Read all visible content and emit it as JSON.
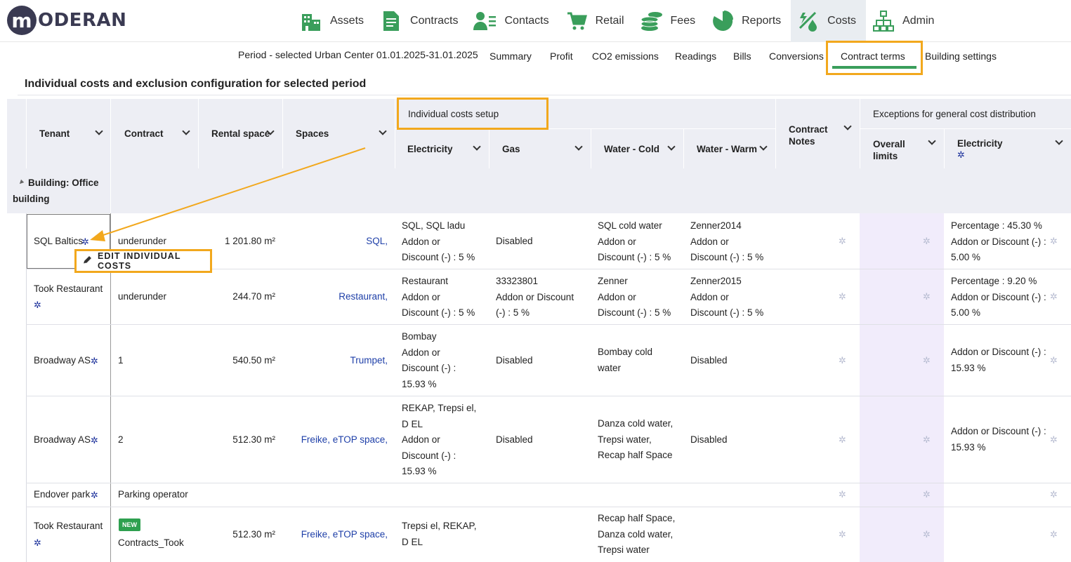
{
  "brand": {
    "logo_letter": "m",
    "logo_text": "ODERAN"
  },
  "nav": [
    {
      "label": "Assets",
      "icon": "building-icon"
    },
    {
      "label": "Contracts",
      "icon": "document-icon"
    },
    {
      "label": "Contacts",
      "icon": "people-icon"
    },
    {
      "label": "Retail",
      "icon": "cart-icon"
    },
    {
      "label": "Fees",
      "icon": "coins-icon"
    },
    {
      "label": "Reports",
      "icon": "pie-chart-icon"
    },
    {
      "label": "Costs",
      "icon": "costs-icon",
      "active": true
    },
    {
      "label": "Admin",
      "icon": "org-chart-icon"
    }
  ],
  "subnav": {
    "period": "Period - selected Urban Center 01.01.2025-31.01.2025",
    "tabs": [
      "Summary",
      "Profit",
      "CO2 emissions",
      "Readings",
      "Bills",
      "Conversions",
      "Contract terms",
      "Building settings"
    ],
    "active_tab": "Contract terms"
  },
  "section_title": "Individual costs and exclusion configuration for selected period",
  "columns": {
    "tenant": "Tenant",
    "contract": "Contract",
    "rental_space": "Rental space",
    "spaces": "Spaces",
    "individual_costs_setup": "Individual costs setup",
    "electricity": "Electricity",
    "gas": "Gas",
    "water_cold": "Water - Cold",
    "water_warm": "Water - Warm",
    "contract_notes": "Contract Notes",
    "exceptions": "Exceptions for general cost distribution",
    "overall_limits": "Overall limits",
    "exc_electricity": "Electricity"
  },
  "group": {
    "label": "Building: Office building"
  },
  "edit_popup": "EDIT INDIVIDUAL COSTS",
  "rows": [
    {
      "tenant": "SQL Baltics",
      "contract": "underunder",
      "rental_space": "1 201.80 m²",
      "spaces": "SQL,",
      "electricity": [
        "SQL, SQL ladu",
        "Addon or",
        "Discount (-) : 5 %"
      ],
      "gas": [
        "Disabled"
      ],
      "water_cold": [
        "SQL cold water",
        "Addon or",
        "Discount (-) : 5 %"
      ],
      "water_warm": [
        "Zenner2014",
        "Addon or",
        "Discount (-) : 5 %"
      ],
      "exc_electricity": [
        "Percentage : 45.30 %",
        "Addon or Discount (-) :",
        "5.00 %"
      ]
    },
    {
      "tenant": "Took Restaurant",
      "contract": "underunder",
      "rental_space": "244.70 m²",
      "spaces": "Restaurant,",
      "electricity": [
        "Restaurant",
        "Addon or",
        "Discount (-) : 5 %"
      ],
      "gas": [
        "33323801",
        "Addon or Discount",
        "(-) : 5 %"
      ],
      "water_cold": [
        "Zenner",
        "Addon or",
        "Discount (-) : 5 %"
      ],
      "water_warm": [
        "Zenner2015",
        "Addon or",
        "Discount (-) : 5 %"
      ],
      "exc_electricity": [
        "Percentage : 9.20 %",
        "Addon or Discount (-) :",
        "5.00 %"
      ]
    },
    {
      "tenant": "Broadway AS",
      "contract": "1",
      "rental_space": "540.50 m²",
      "spaces": "Trumpet,",
      "electricity": [
        "Bombay",
        "Addon or",
        "Discount (-) :",
        "15.93 %"
      ],
      "gas": [
        "Disabled"
      ],
      "water_cold": [
        "Bombay cold",
        "water"
      ],
      "water_warm": [
        "Disabled"
      ],
      "exc_electricity": [
        "Addon or Discount (-) :",
        "15.93 %"
      ]
    },
    {
      "tenant": "Broadway AS",
      "contract": "2",
      "rental_space": "512.30 m²",
      "spaces": "Freike, eTOP space,",
      "electricity": [
        "REKAP, Trepsi el,",
        "D EL",
        "Addon or",
        "Discount (-) :",
        "15.93 %"
      ],
      "gas": [
        "Disabled"
      ],
      "water_cold": [
        "Danza cold water,",
        "Trepsi water,",
        "Recap half Space"
      ],
      "water_warm": [
        "Disabled"
      ],
      "exc_electricity": [
        "Addon or Discount (-) :",
        "15.93 %"
      ]
    },
    {
      "tenant": "Endover park",
      "contract": "Parking operator",
      "rental_space": "",
      "spaces": "",
      "electricity": [],
      "gas": [],
      "water_cold": [],
      "water_warm": [],
      "exc_electricity": []
    },
    {
      "tenant": "Took Restaurant",
      "badge": "NEW",
      "contract": "Contracts_Took",
      "rental_space": "512.30 m²",
      "spaces": "Freike, eTOP space,",
      "electricity": [
        "Trepsi el, REKAP,",
        "D EL"
      ],
      "gas": [],
      "water_cold": [
        "Recap half Space,",
        "Danza cold water,",
        "Trepsi water"
      ],
      "water_warm": [],
      "exc_electricity": []
    }
  ],
  "colors": {
    "accent_green": "#3a9e5b",
    "highlight_orange": "#f2a81d",
    "gear_blue": "#1a2f9a",
    "header_bg": "#edeef4",
    "purple_col": "#f1ecfb"
  }
}
